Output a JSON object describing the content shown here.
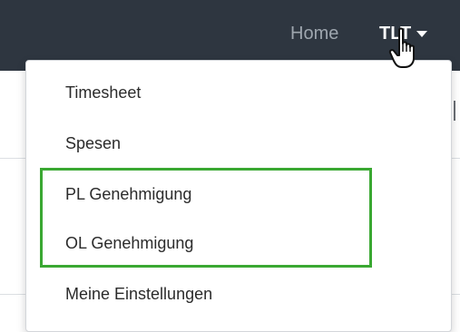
{
  "navbar": {
    "home_label": "Home",
    "user_label": "TLT",
    "caret_icon": "caret-down-icon",
    "background_color": "#2e3640"
  },
  "dropdown": {
    "items": [
      {
        "label": "Timesheet"
      },
      {
        "label": "Spesen"
      },
      {
        "label": "PL Genehmigung"
      },
      {
        "label": "OL Genehmigung"
      },
      {
        "label": "Meine Einstellungen"
      }
    ]
  },
  "highlight": {
    "color": "#3aa832"
  },
  "cursor": {
    "icon": "hand-pointer-icon"
  }
}
